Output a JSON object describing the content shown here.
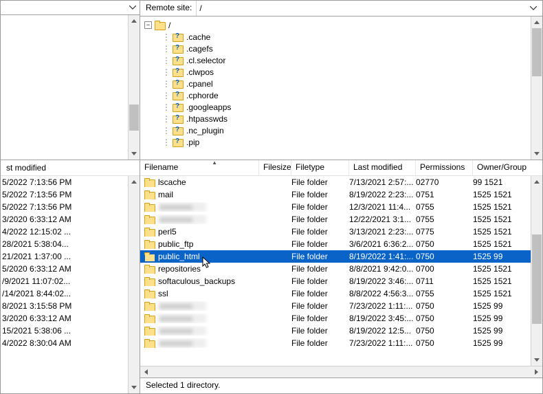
{
  "left": {
    "header_label": "st modified",
    "rows": [
      "5/2022 7:13:56 PM",
      "5/2022 7:13:56 PM",
      "5/2022 7:13:56 PM",
      "3/2020 6:33:12 AM",
      "4/2022 12:15:02 ...",
      "28/2021 5:38:04...",
      "21/2021 1:37:00 ...",
      "5/2020 6:33:12 AM",
      "/9/2021 11:07:02...",
      "/14/2021 8:44:02...",
      "8/2021 3:15:58 PM",
      "3/2020 6:33:12 AM",
      "15/2021 5:38:06 ...",
      "4/2022 8:30:04 AM"
    ]
  },
  "remote": {
    "label": "Remote site:",
    "path": "/"
  },
  "tree": {
    "root": "/",
    "items": [
      ".cache",
      ".cagefs",
      ".cl.selector",
      ".clwpos",
      ".cpanel",
      ".cphorde",
      ".googleapps",
      ".htpasswds",
      ".nc_plugin",
      ".pip"
    ]
  },
  "file_headers": {
    "name": "Filename",
    "size": "Filesize",
    "type": "Filetype",
    "mod": "Last modified",
    "perm": "Permissions",
    "own": "Owner/Group"
  },
  "files": [
    {
      "name": "lscache",
      "type": "File folder",
      "mod": "7/13/2021 2:57:...",
      "perm": "02770",
      "own": "99 1521"
    },
    {
      "name": "mail",
      "type": "File folder",
      "mod": "8/19/2022 2:23:...",
      "perm": "0751",
      "own": "1525 1521"
    },
    {
      "name": "",
      "blur": true,
      "type": "File folder",
      "mod": "12/3/2021 11:4...",
      "perm": "0755",
      "own": "1525 1521"
    },
    {
      "name": "",
      "blur": true,
      "type": "File folder",
      "mod": "12/22/2021 3:1...",
      "perm": "0755",
      "own": "1525 1521"
    },
    {
      "name": "perl5",
      "type": "File folder",
      "mod": "3/13/2021 2:23:...",
      "perm": "0775",
      "own": "1525 1521"
    },
    {
      "name": "public_ftp",
      "type": "File folder",
      "mod": "3/6/2021 6:36:2...",
      "perm": "0750",
      "own": "1525 1521"
    },
    {
      "name": "public_html",
      "sel": true,
      "type": "File folder",
      "mod": "8/19/2022 1:41:...",
      "perm": "0750",
      "own": "1525 99"
    },
    {
      "name": "repositories",
      "type": "File folder",
      "mod": "8/8/2021 9:42:0...",
      "perm": "0700",
      "own": "1525 1521"
    },
    {
      "name": "softaculous_backups",
      "type": "File folder",
      "mod": "8/19/2022 3:46:...",
      "perm": "0711",
      "own": "1525 1521"
    },
    {
      "name": "ssl",
      "type": "File folder",
      "mod": "8/8/2022 4:56:3...",
      "perm": "0755",
      "own": "1525 1521"
    },
    {
      "name": "",
      "blur": true,
      "type": "File folder",
      "mod": "7/23/2022 1:11:...",
      "perm": "0750",
      "own": "1525 99"
    },
    {
      "name": "",
      "blur": true,
      "type": "File folder",
      "mod": "8/19/2022 3:45:...",
      "perm": "0750",
      "own": "1525 99"
    },
    {
      "name": "",
      "blur": true,
      "type": "File folder",
      "mod": "8/19/2022 12:5...",
      "perm": "0750",
      "own": "1525 99"
    },
    {
      "name": "",
      "blur": true,
      "type": "File folder",
      "mod": "7/23/2022 1:11:...",
      "perm": "0750",
      "own": "1525 99"
    }
  ],
  "status": "Selected 1 directory."
}
